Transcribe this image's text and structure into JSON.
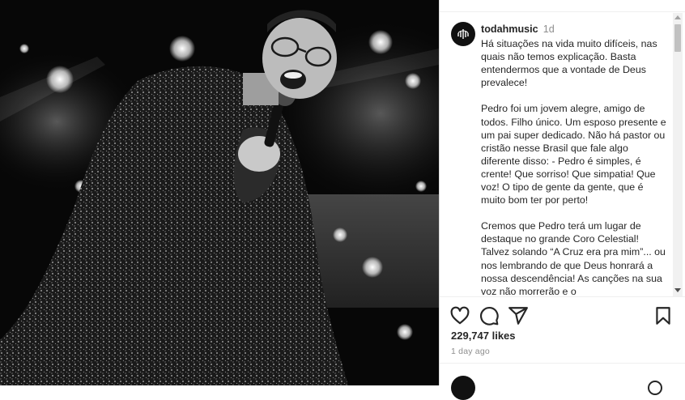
{
  "post": {
    "username": "todahmusic",
    "time_ago": "1d",
    "caption_paragraphs": [
      "Há situações na vida muito difíceis, nas quais não temos explicação. Basta entendermos que a vontade de Deus prevalece!",
      "Pedro foi um jovem alegre, amigo de todos. Filho único. Um esposo presente e um pai super dedicado. Não há pastor ou cristão nesse Brasil que fale algo diferente disso: - Pedro é simples, é crente! Que sorriso! Que simpatia! Que voz! O tipo de gente da gente, que é muito bom ter por perto!",
      "Cremos que Pedro terá um lugar de destaque no grande Coro Celestial! Talvez solando “A Cruz era pra mim”... ou nos lembrando de que Deus honrará a nossa descendência! As canções na sua voz não morrerão e o"
    ],
    "likes": "229,747 likes",
    "date": "1 day ago"
  },
  "icons": {
    "like": "heart-icon",
    "comment": "comment-icon",
    "share": "share-icon",
    "save": "bookmark-icon",
    "avatar": "todah-logo-icon"
  },
  "colors": {
    "text": "#262626",
    "secondary": "#8e8e8e",
    "divider": "#efefef"
  }
}
